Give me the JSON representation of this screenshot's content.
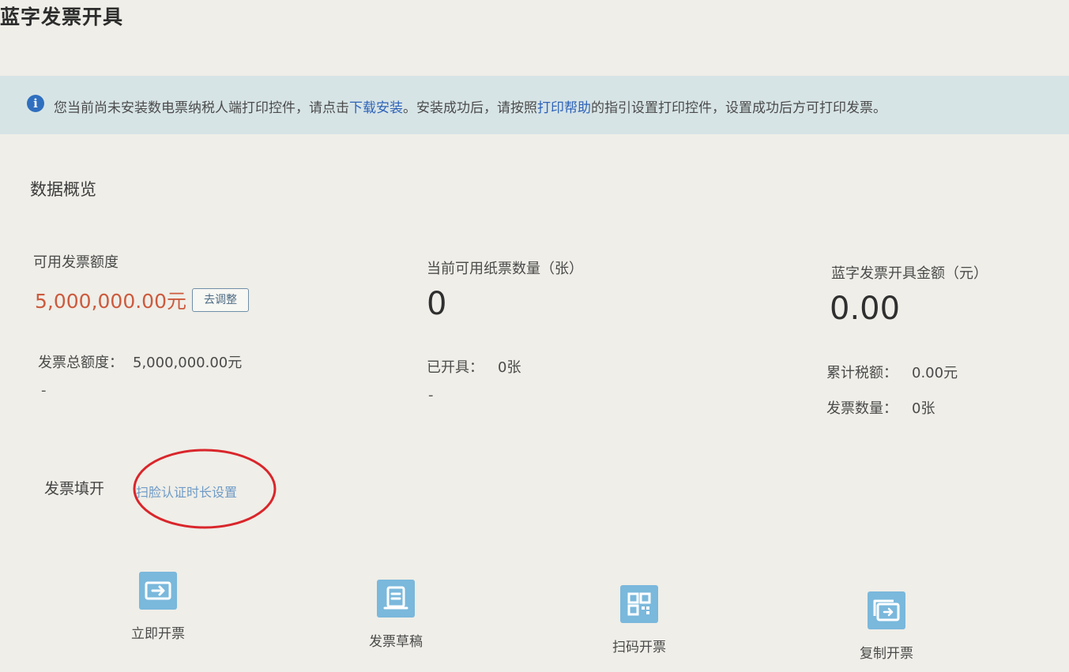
{
  "page": {
    "title": "蓝字发票开具"
  },
  "notice": {
    "prefix": "您当前尚未安装数电票纳税人端打印控件，请点击",
    "download_link": "下载安装",
    "middle": "。安装成功后，请按照",
    "help_link": "打印帮助",
    "suffix": "的指引设置打印控件，设置成功后方可打印发票。"
  },
  "overview": {
    "title": "数据概览",
    "quota": {
      "label": "可用发票额度",
      "value": "5,000,000.00元",
      "adjust_button": "去调整",
      "total_label": "发票总额度：",
      "total_value": "5,000,000.00元",
      "dash": "-"
    },
    "paper": {
      "label": "当前可用纸票数量（张）",
      "value": "0",
      "issued_label": "已开具：",
      "issued_value": "0张",
      "dash": "-"
    },
    "blue_invoice": {
      "label": "蓝字发票开具金额（元）",
      "value": "0.00",
      "tax_label": "累计税额：",
      "tax_value": "0.00元",
      "count_label": "发票数量：",
      "count_value": "0张"
    }
  },
  "invoice_fill": {
    "label": "发票填开",
    "auth_link": "扫脸认证时长设置"
  },
  "actions": [
    {
      "label": "立即开票",
      "icon": "invoice-issue-icon"
    },
    {
      "label": "发票草稿",
      "icon": "invoice-draft-icon"
    },
    {
      "label": "扫码开票",
      "icon": "qr-code-icon"
    },
    {
      "label": "复制开票",
      "icon": "copy-invoice-icon"
    }
  ],
  "colors": {
    "accent": "#2e63b8",
    "quota_value": "#cc5a3e",
    "icon_blue": "#7ab8dc",
    "notice_bg": "#d7e4e6",
    "annotation_red": "#d9262b"
  }
}
